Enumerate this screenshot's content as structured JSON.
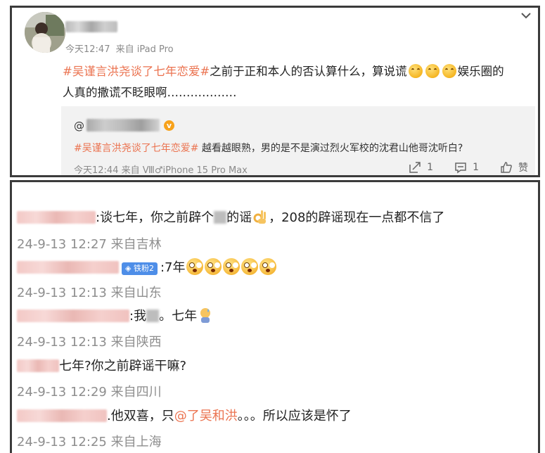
{
  "post": {
    "meta_time": "今天12:47",
    "meta_source": "来自 iPad Pro",
    "hashtag": "#吴谨言洪尧谈了七年恋爱#",
    "text_line1": "之前于正和本人的否认算什么，算说谎",
    "text_line1_tail": "娱乐圈的",
    "text_line2": "人真的撒谎不眨眼啊………………",
    "emoji_name": "smile-hands-emoji"
  },
  "quote": {
    "at_symbol": "@",
    "hashtag": "#吴谨言洪尧谈了七年恋爱#",
    "text": " 越看越眼熟，男的是不是演过烈火军校的沈君山他哥沈听白?",
    "verify_icon": "v",
    "meta_time": "今天12:44",
    "meta_source": "来自 Ⅷ♂iPhone 15 Pro Max",
    "repost_count": "1",
    "comment_count": "1",
    "like_label": "赞"
  },
  "comments": [
    {
      "text": ":谈七年，你之前辟个",
      "text_tail": "的谣",
      "text_end": "，208的辟谣现在一点都不信了",
      "time": "24-9-13 12:27",
      "location": "来自吉林"
    },
    {
      "badge": "◈ 铁粉2",
      "text": ":7年",
      "time": "24-9-13 12:13",
      "location": "来自山东"
    },
    {
      "text": ":我",
      "text_tail": "。七年",
      "time": "24-9-13 12:13",
      "location": "来自陕西"
    },
    {
      "text": "七年?你之前辟谣干嘛?",
      "time": "24-9-13 12:29",
      "location": "来自四川"
    },
    {
      "text": ".他双喜，只",
      "mention": "@了吴和洪",
      "text_tail": "。。。所以应该是怀了",
      "time": "24-9-13 12:25",
      "location": "来自上海"
    }
  ],
  "colors": {
    "hashtag": "#eb7350",
    "meta": "#8a8a8a",
    "quote_bg": "#f2f2f2",
    "fan_badge": "#4e8ee8"
  }
}
